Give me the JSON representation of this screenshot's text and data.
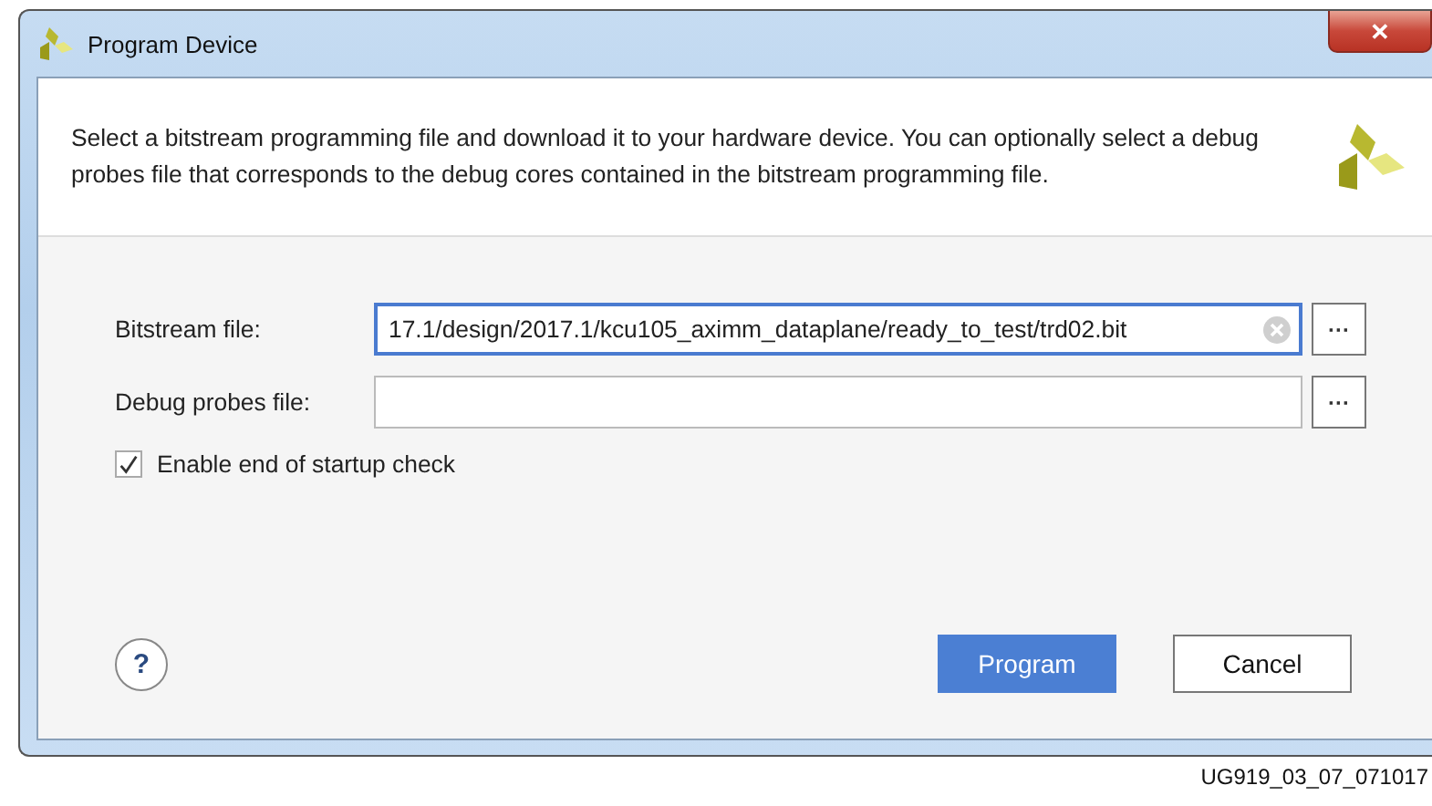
{
  "window": {
    "title": "Program Device",
    "close": "✕"
  },
  "description": "Select a bitstream programming file and download it to your hardware device. You can optionally select a debug probes file that corresponds to the debug cores contained in the bitstream programming file.",
  "fields": [
    {
      "label": "Bitstream file:",
      "value": "17.1/design/2017.1/kcu105_aximm_dataplane/ready_to_test/trd02.bit",
      "focused": true,
      "clearable": true,
      "browse": "···"
    },
    {
      "label": "Debug probes file:",
      "focused": false,
      "clearable": false,
      "browse": "···"
    }
  ],
  "checkbox": {
    "label": "Enable end of startup check",
    "checked": true
  },
  "help": "?",
  "buttons": [
    {
      "label": "Program",
      "kind": "primary"
    },
    {
      "label": "Cancel",
      "kind": "normal"
    }
  ],
  "caption": "UG919_03_07_071017"
}
